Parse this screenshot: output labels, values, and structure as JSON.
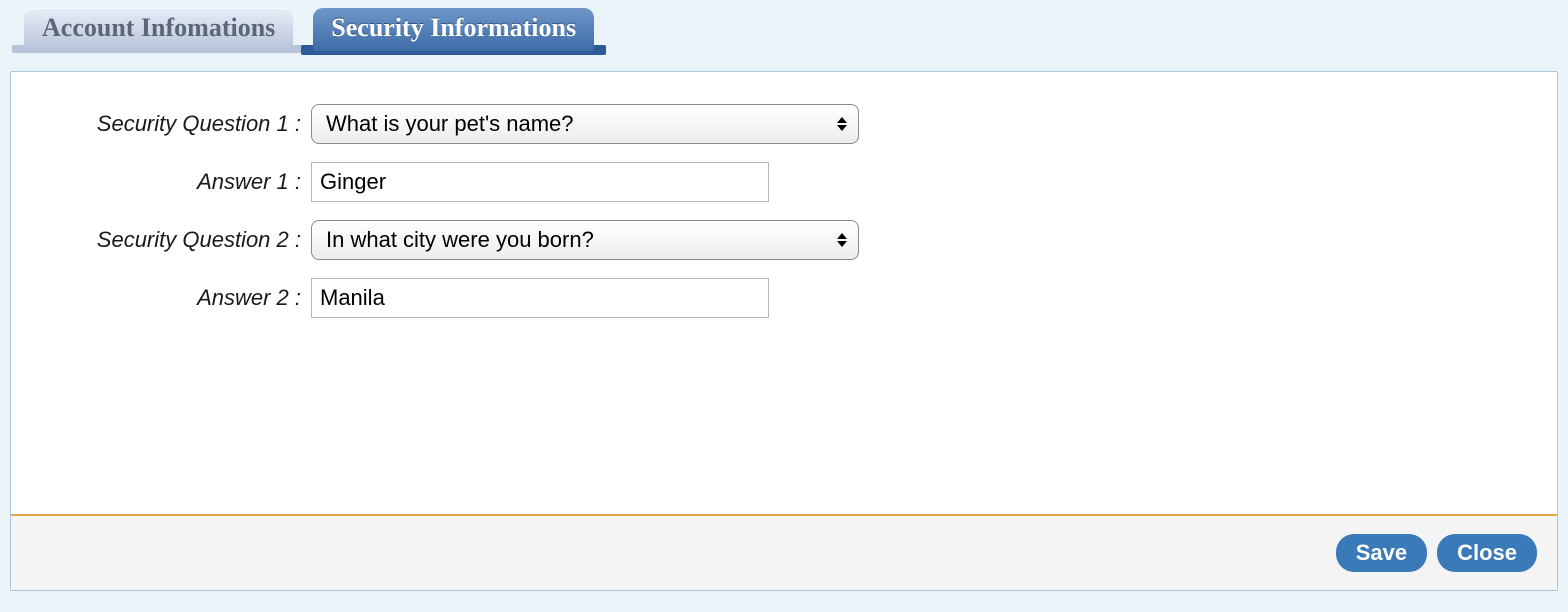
{
  "tabs": {
    "account": "Account Infomations",
    "security": "Security Informations"
  },
  "form": {
    "q1_label": "Security Question 1 :",
    "q1_value": "What is your pet's name?",
    "a1_label": "Answer 1 :",
    "a1_value": "Ginger",
    "q2_label": "Security Question 2 :",
    "q2_value": "In what city were you born?",
    "a2_label": "Answer 2 :",
    "a2_value": "Manila"
  },
  "footer": {
    "save": "Save",
    "close": "Close"
  }
}
